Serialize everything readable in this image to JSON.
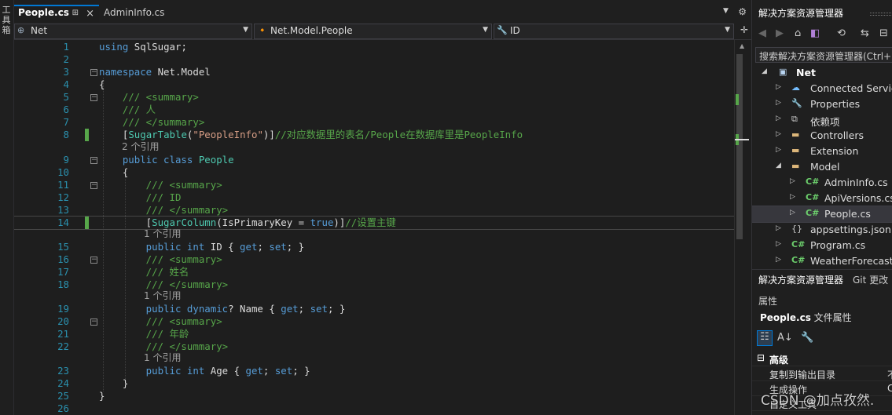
{
  "toolbox": {
    "label": "工具箱"
  },
  "tabs": [
    {
      "label": "People.cs",
      "active": true
    },
    {
      "label": "AdminInfo.cs",
      "active": false
    }
  ],
  "navbar": {
    "project": "Net",
    "type": "Net.Model.People",
    "member": "ID"
  },
  "code_lines": [
    {
      "n": "1",
      "parts": [
        [
          "kw",
          "using"
        ],
        [
          "tx",
          " SqlSugar;"
        ]
      ]
    },
    {
      "n": "2",
      "parts": []
    },
    {
      "n": "3",
      "parts": [
        [
          "kw",
          "namespace"
        ],
        [
          "tx",
          " Net.Model"
        ]
      ]
    },
    {
      "n": "4",
      "parts": [
        [
          "tx",
          "{"
        ]
      ]
    },
    {
      "n": "5",
      "parts": [
        [
          "cm",
          "    /// <summary>"
        ]
      ]
    },
    {
      "n": "6",
      "parts": [
        [
          "cm",
          "    /// 人"
        ]
      ]
    },
    {
      "n": "7",
      "parts": [
        [
          "cm",
          "    /// </summary>"
        ]
      ]
    },
    {
      "n": "8",
      "parts": [
        [
          "tx",
          "    ["
        ],
        [
          "ty",
          "SugarTable"
        ],
        [
          "tx",
          "("
        ],
        [
          "str",
          "\"PeopleInfo\""
        ],
        [
          "tx",
          ")]"
        ],
        [
          "cm",
          "//对应数据里的表名/People在数据库里是PeopleInfo"
        ]
      ]
    },
    {
      "n": "9",
      "parts": [
        [
          "kw",
          "    public class "
        ],
        [
          "ty",
          "People"
        ]
      ]
    },
    {
      "n": "10",
      "parts": [
        [
          "tx",
          "    {"
        ]
      ]
    },
    {
      "n": "11",
      "parts": [
        [
          "cm",
          "        /// <summary>"
        ]
      ]
    },
    {
      "n": "12",
      "parts": [
        [
          "cm",
          "        /// ID"
        ]
      ]
    },
    {
      "n": "13",
      "parts": [
        [
          "cm",
          "        /// </summary>"
        ]
      ]
    },
    {
      "n": "14",
      "parts": [
        [
          "tx",
          "        ["
        ],
        [
          "ty",
          "SugarColumn"
        ],
        [
          "tx",
          "(IsPrimaryKey = "
        ],
        [
          "kw",
          "true"
        ],
        [
          "tx",
          ")]"
        ],
        [
          "cm",
          "//设置主键"
        ]
      ]
    },
    {
      "n": "15",
      "parts": [
        [
          "kw",
          "        public int"
        ],
        [
          "tx",
          " ID { "
        ],
        [
          "kw",
          "get"
        ],
        [
          "tx",
          "; "
        ],
        [
          "kw",
          "set"
        ],
        [
          "tx",
          "; }"
        ]
      ]
    },
    {
      "n": "16",
      "parts": [
        [
          "cm",
          "        /// <summary>"
        ]
      ]
    },
    {
      "n": "17",
      "parts": [
        [
          "cm",
          "        /// 姓名"
        ]
      ]
    },
    {
      "n": "18",
      "parts": [
        [
          "cm",
          "        /// </summary>"
        ]
      ]
    },
    {
      "n": "19",
      "parts": [
        [
          "kw",
          "        public dynamic"
        ],
        [
          "tx",
          "? Name { "
        ],
        [
          "kw",
          "get"
        ],
        [
          "tx",
          "; "
        ],
        [
          "kw",
          "set"
        ],
        [
          "tx",
          "; }"
        ]
      ]
    },
    {
      "n": "20",
      "parts": [
        [
          "cm",
          "        /// <summary>"
        ]
      ]
    },
    {
      "n": "21",
      "parts": [
        [
          "cm",
          "        /// 年龄"
        ]
      ]
    },
    {
      "n": "22",
      "parts": [
        [
          "cm",
          "        /// </summary>"
        ]
      ]
    },
    {
      "n": "23",
      "parts": [
        [
          "kw",
          "        public int"
        ],
        [
          "tx",
          " Age { "
        ],
        [
          "kw",
          "get"
        ],
        [
          "tx",
          "; "
        ],
        [
          "kw",
          "set"
        ],
        [
          "tx",
          "; }"
        ]
      ]
    },
    {
      "n": "24",
      "parts": [
        [
          "tx",
          "    }"
        ]
      ]
    },
    {
      "n": "25",
      "parts": [
        [
          "tx",
          "}"
        ]
      ]
    },
    {
      "n": "26",
      "parts": []
    }
  ],
  "codelens": {
    "class_refs": "2 个引用",
    "member_refs": "1 个引用"
  },
  "solution_explorer": {
    "title": "解决方案资源管理器",
    "search_placeholder": "搜索解决方案资源管理器(Ctrl+;)",
    "items": [
      {
        "label": "Net",
        "icon": "project-icon"
      },
      {
        "label": "Connected Services",
        "icon": "connected-services-icon"
      },
      {
        "label": "Properties",
        "icon": "properties-icon"
      },
      {
        "label": "依赖项",
        "icon": "dependencies-icon"
      },
      {
        "label": "Controllers",
        "icon": "folder-icon"
      },
      {
        "label": "Extension",
        "icon": "folder-icon"
      },
      {
        "label": "Model",
        "icon": "folder-icon"
      },
      {
        "label": "AdminInfo.cs",
        "icon": "csharp-file-icon"
      },
      {
        "label": "ApiVersions.cs",
        "icon": "csharp-file-icon"
      },
      {
        "label": "People.cs",
        "icon": "csharp-file-icon"
      },
      {
        "label": "appsettings.json",
        "icon": "json-file-icon"
      },
      {
        "label": "Program.cs",
        "icon": "csharp-file-icon"
      },
      {
        "label": "WeatherForecast.cs",
        "icon": "csharp-file-icon"
      }
    ],
    "tabs": [
      "解决方案资源管理器",
      "Git 更改"
    ]
  },
  "properties": {
    "title": "属性",
    "file": "People.cs",
    "file_suffix": "文件属性",
    "section": "高级",
    "rows": [
      {
        "name": "复制到输出目录",
        "value": "不"
      },
      {
        "name": "生成操作",
        "value": "C"
      },
      {
        "name": "自定义工具",
        "value": ""
      }
    ]
  },
  "watermark": "CSDN @加点孜然."
}
